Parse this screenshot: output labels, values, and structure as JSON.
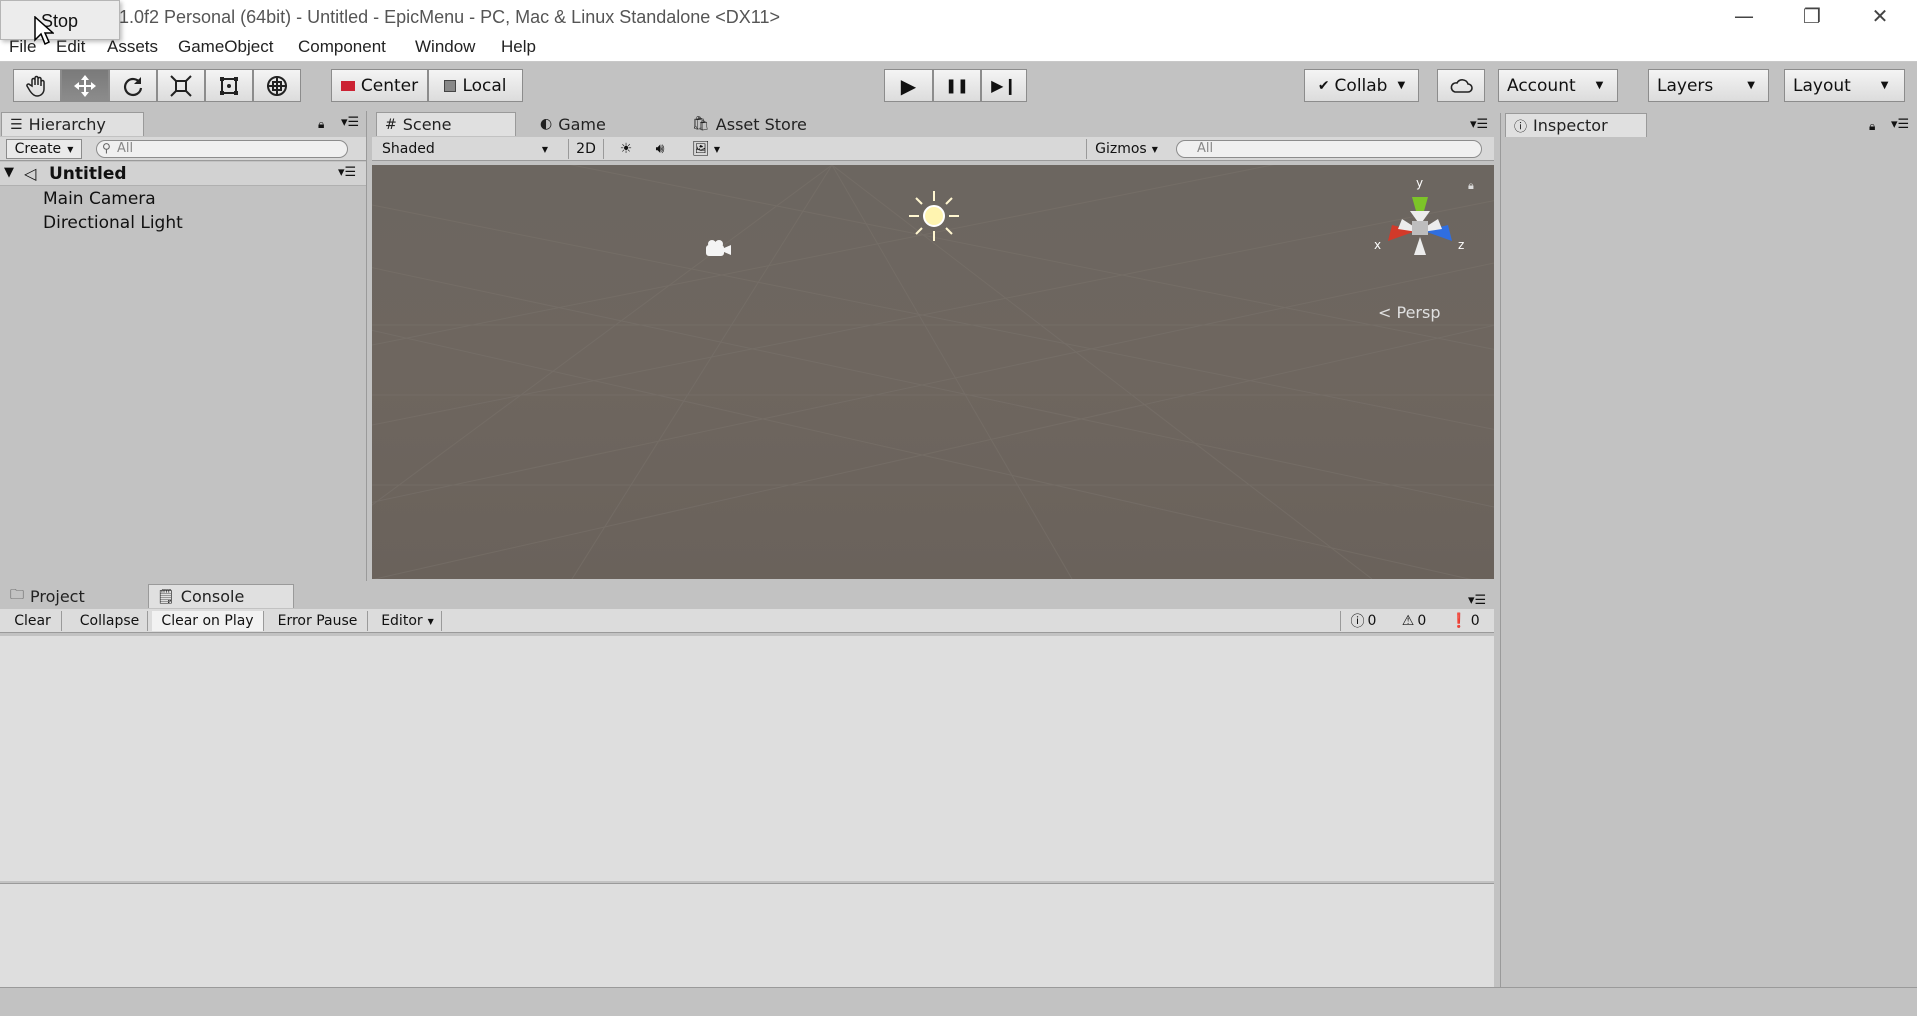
{
  "window": {
    "title": "1.0f2 Personal (64bit) - Untitled - EpicMenu - PC, Mac & Linux Standalone <DX11>",
    "popup_label": "Stop",
    "minimize": "—",
    "restore": "❐",
    "close": "✕"
  },
  "menu": [
    "File",
    "Edit",
    "Assets",
    "GameObject",
    "Component",
    "Window",
    "Help"
  ],
  "toolbar": {
    "tools": [
      "hand-icon",
      "move-icon",
      "rotate-icon",
      "scale-icon",
      "rect-icon",
      "transform-icon"
    ],
    "pivot": "Center",
    "space": "Local",
    "play": "▶",
    "pause": "❚❚",
    "step": "▶❙",
    "collab": "Collab",
    "account": "Account",
    "layers": "Layers",
    "layout": "Layout"
  },
  "hierarchy": {
    "tab": "Hierarchy",
    "create": "Create",
    "search_placeholder": "All",
    "scene_name": "Untitled",
    "items": [
      "Main Camera",
      "Directional Light"
    ]
  },
  "scene": {
    "tabs": [
      "Scene",
      "Game",
      "Asset Store"
    ],
    "shading": "Shaded",
    "mode_2d": "2D",
    "gizmos": "Gizmos",
    "search_placeholder": "All",
    "persp": "Persp",
    "axis_labels": {
      "x": "x",
      "y": "y",
      "z": "z"
    }
  },
  "bottom": {
    "tabs": [
      "Project",
      "Console"
    ],
    "buttons": [
      "Clear",
      "Collapse",
      "Clear on Play",
      "Error Pause",
      "Editor"
    ],
    "counts": {
      "info": "0",
      "warn": "0",
      "error": "0"
    }
  },
  "inspector": {
    "tab": "Inspector"
  },
  "colors": {
    "accent_y": "#7cc428",
    "accent_x": "#d23a2a",
    "accent_z": "#2f6ee0"
  }
}
